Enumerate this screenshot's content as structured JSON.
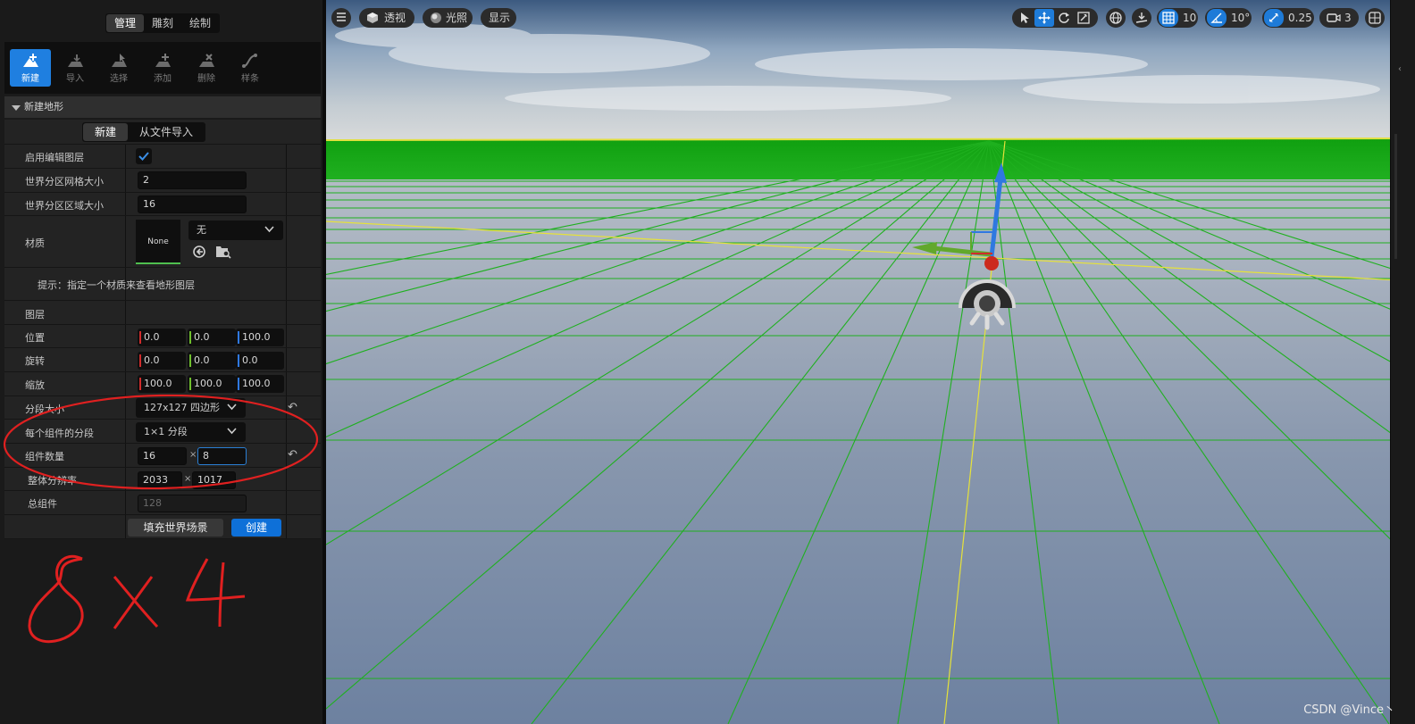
{
  "mode_tabs": [
    "管理",
    "雕刻",
    "绘制"
  ],
  "tools": [
    {
      "label": "新建",
      "icon": "new-landscape-icon"
    },
    {
      "label": "导入",
      "icon": "import-icon"
    },
    {
      "label": "选择",
      "icon": "select-icon"
    },
    {
      "label": "添加",
      "icon": "add-icon"
    },
    {
      "label": "删除",
      "icon": "delete-icon"
    },
    {
      "label": "样条",
      "icon": "spline-icon"
    }
  ],
  "section_title": "新建地形",
  "sub_tabs": [
    "新建",
    "从文件导入"
  ],
  "props": {
    "enable_edit_layers": {
      "label": "启用编辑图层",
      "checked": true
    },
    "grid_size": {
      "label": "世界分区网格大小",
      "value": "2"
    },
    "region_size": {
      "label": "世界分区区域大小",
      "value": "16"
    },
    "material": {
      "label": "材质",
      "thumb": "None",
      "dropdown": "无"
    },
    "hint": "提示：指定一个材质来查看地形图层",
    "layers": {
      "label": "图层"
    },
    "location": {
      "label": "位置",
      "x": "0.0",
      "y": "0.0",
      "z": "100.0"
    },
    "rotation": {
      "label": "旋转",
      "x": "0.0",
      "y": "0.0",
      "z": "0.0"
    },
    "scale": {
      "label": "缩放",
      "x": "100.0",
      "y": "100.0",
      "z": "100.0"
    },
    "section_size": {
      "label": "分段大小",
      "value": "127x127 四边形"
    },
    "sections_per_component": {
      "label": "每个组件的分段",
      "value": "1×1 分段"
    },
    "component_count": {
      "label": "组件数量",
      "x": "16",
      "sep": "×",
      "y": "8"
    },
    "overall_resolution": {
      "label": "整体分辨率",
      "x": "2033",
      "sep": "×",
      "y": "1017"
    },
    "total_components": {
      "label": "总组件",
      "value": "128"
    }
  },
  "buttons": {
    "fill_world": "填充世界场景",
    "create": "创建"
  },
  "annotation": {
    "text": "8x4",
    "color": "#e02020"
  },
  "viewport": {
    "perspective": "透视",
    "lighting": "光照",
    "show": "显示",
    "grid_snap": "10",
    "rotation_snap": "10°",
    "scale_snap": "0.25",
    "camera_speed": "3"
  },
  "watermark": "CSDN @Vince丶",
  "colors": {
    "accent": "#1f7fe0",
    "axis_x": "#d02c2c",
    "axis_y": "#6fbf2c",
    "axis_z": "#2f78e0",
    "ground_grid": "#1fb01f"
  }
}
